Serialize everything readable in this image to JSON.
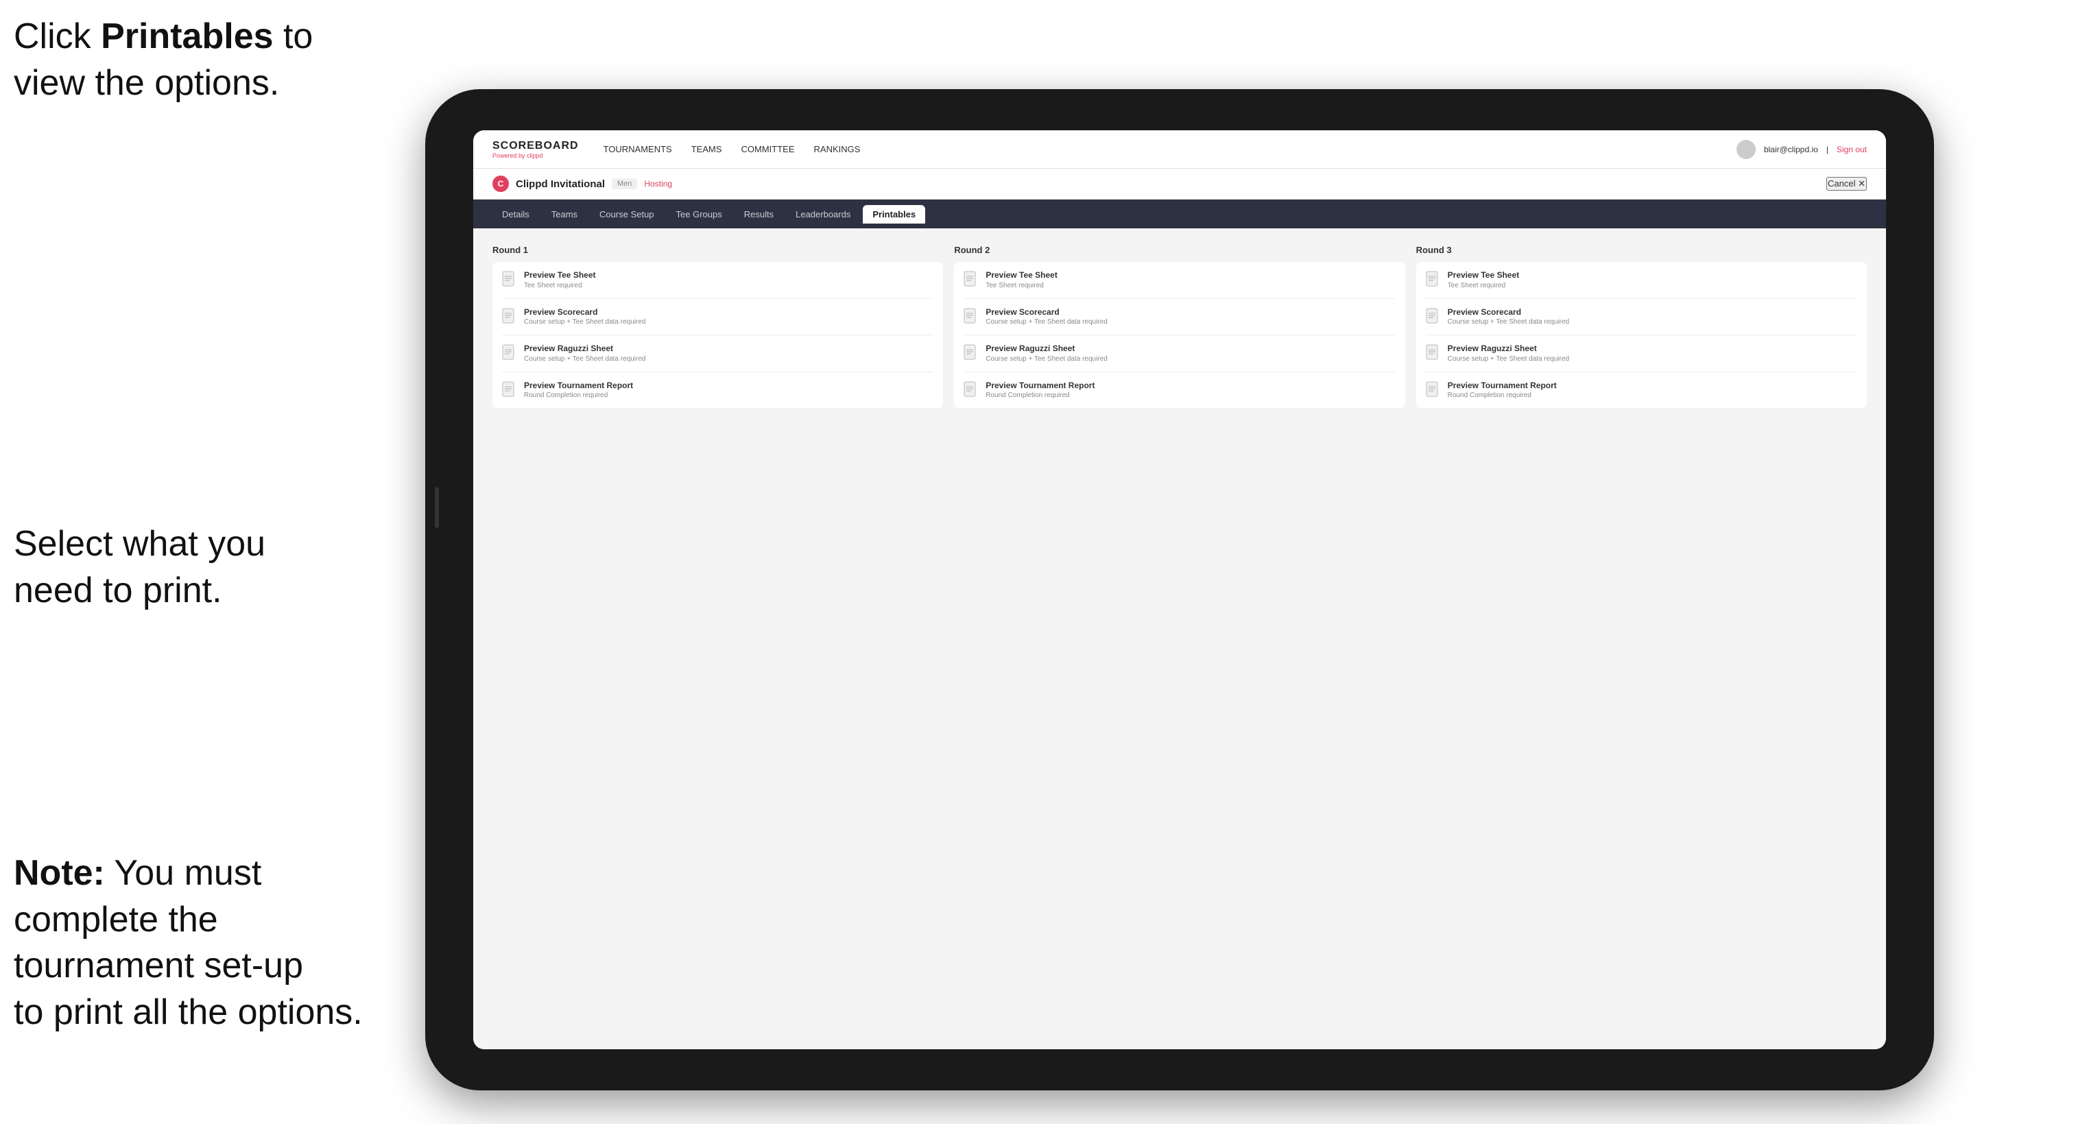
{
  "annotations": {
    "top": {
      "text_before": "Click ",
      "text_bold": "Printables",
      "text_after": " to\nview the options."
    },
    "mid": {
      "line1": "Select what you",
      "line2": "need to print."
    },
    "bot": {
      "bold": "Note:",
      "text": " You must\ncomplete the\ntournament set-up\nto print all the options."
    }
  },
  "nav": {
    "logo": "SCOREBOARD",
    "logo_sub": "Powered by clippd",
    "items": [
      "TOURNAMENTS",
      "TEAMS",
      "COMMITTEE",
      "RANKINGS"
    ],
    "user_email": "blair@clippd.io",
    "sign_out": "Sign out"
  },
  "tournament": {
    "name": "Clippd Invitational",
    "tag": "Men",
    "hosting": "Hosting",
    "cancel": "Cancel ✕"
  },
  "sub_nav": {
    "tabs": [
      "Details",
      "Teams",
      "Course Setup",
      "Tee Groups",
      "Results",
      "Leaderboards",
      "Printables"
    ],
    "active": "Printables"
  },
  "rounds": [
    {
      "title": "Round 1",
      "items": [
        {
          "title": "Preview Tee Sheet",
          "subtitle": "Tee Sheet required"
        },
        {
          "title": "Preview Scorecard",
          "subtitle": "Course setup + Tee Sheet data required"
        },
        {
          "title": "Preview Raguzzi Sheet",
          "subtitle": "Course setup + Tee Sheet data required"
        },
        {
          "title": "Preview Tournament Report",
          "subtitle": "Round Completion required"
        }
      ]
    },
    {
      "title": "Round 2",
      "items": [
        {
          "title": "Preview Tee Sheet",
          "subtitle": "Tee Sheet required"
        },
        {
          "title": "Preview Scorecard",
          "subtitle": "Course setup + Tee Sheet data required"
        },
        {
          "title": "Preview Raguzzi Sheet",
          "subtitle": "Course setup + Tee Sheet data required"
        },
        {
          "title": "Preview Tournament Report",
          "subtitle": "Round Completion required"
        }
      ]
    },
    {
      "title": "Round 3",
      "items": [
        {
          "title": "Preview Tee Sheet",
          "subtitle": "Tee Sheet required"
        },
        {
          "title": "Preview Scorecard",
          "subtitle": "Course setup + Tee Sheet data required"
        },
        {
          "title": "Preview Raguzzi Sheet",
          "subtitle": "Course setup + Tee Sheet data required"
        },
        {
          "title": "Preview Tournament Report",
          "subtitle": "Round Completion required"
        }
      ]
    }
  ],
  "colors": {
    "accent": "#e04060",
    "nav_bg": "#2d3142",
    "active_tab_bg": "#ffffff"
  }
}
